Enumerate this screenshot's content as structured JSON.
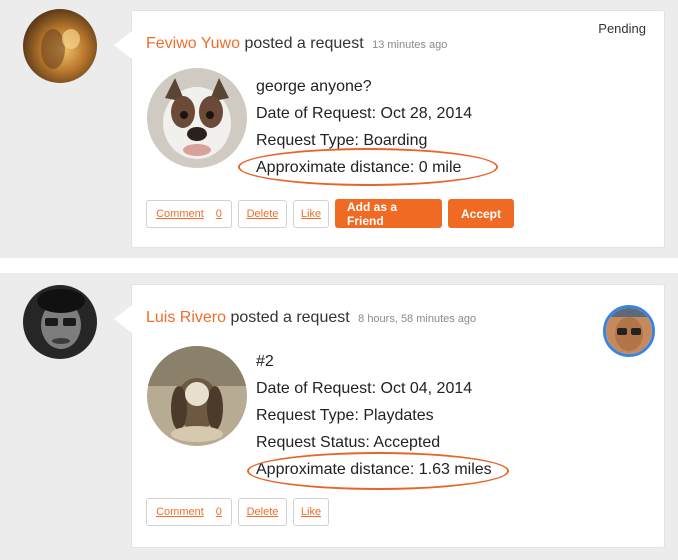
{
  "posts": [
    {
      "poster_name": "Feviwo Yuwo",
      "action_text": "posted a request",
      "time_ago": "13 minutes ago",
      "status": "Pending",
      "title": "george anyone?",
      "date_line": "Date of Request: Oct 28, 2014",
      "type_line": "Request Type: Boarding",
      "distance_line": "Approximate distance: 0 mile",
      "buttons": {
        "comment": "Comment",
        "comment_count": "0",
        "delete": "Delete",
        "like": "Like",
        "add_friend": "Add as a Friend",
        "accept": "Accept"
      }
    },
    {
      "poster_name": "Luis Rivero",
      "action_text": "posted a request",
      "time_ago": "8 hours, 58 minutes ago",
      "title": "#2",
      "date_line": "Date of Request: Oct 04, 2014",
      "type_line": "Request Type: Playdates",
      "status_line": "Request Status: Accepted",
      "distance_line": "Approximate distance: 1.63 miles",
      "buttons": {
        "comment": "Comment",
        "comment_count": "0",
        "delete": "Delete",
        "like": "Like"
      }
    }
  ],
  "colors": {
    "accent": "#ef6e2a",
    "highlight": "#e8642a",
    "accepter_ring": "#3a82e4",
    "background": "#ececec"
  }
}
